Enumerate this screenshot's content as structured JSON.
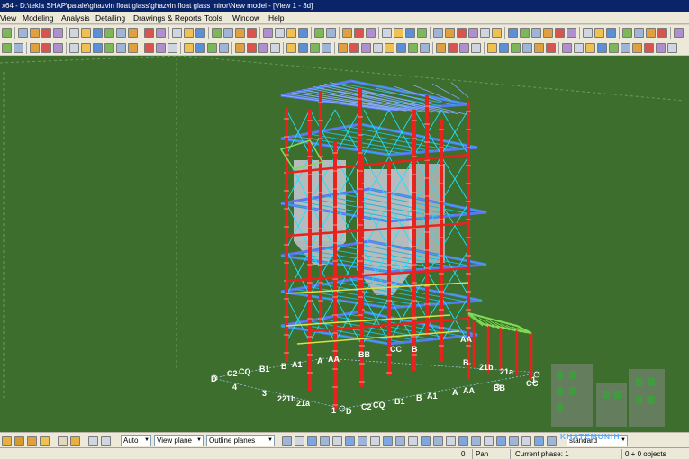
{
  "window": {
    "title": "x64 - D:\\tekla SHAP\\patale\\ghazvin float glass\\ghazvin float glass miror\\New model  - [View 1 - 3d]"
  },
  "menu": {
    "items": [
      "View",
      "Modeling",
      "Analysis",
      "Detailing",
      "Drawings & Reports",
      "Tools",
      "Window",
      "Help"
    ]
  },
  "bottom_toolbar": {
    "select_mode": "Auto",
    "work_plane": "View plane",
    "plane_type": "Outline planes"
  },
  "status": {
    "settings": "standard",
    "x": "0",
    "mode": "Pan",
    "phase": "Current phase: 1",
    "selection": "0 + 0 objects"
  },
  "axis_labels": {
    "front_row": [
      "4",
      "3",
      "2",
      "21b",
      "21a",
      "1"
    ],
    "front_grid": [
      "C2",
      "CQ",
      "B1",
      "B",
      "A1",
      "A",
      "AA"
    ],
    "bottom_grid": [
      "D",
      "C2",
      "CQ",
      "B1",
      "B",
      "A1",
      "A",
      "AA"
    ],
    "left_marks": [
      "D",
      "4"
    ],
    "right_row": [
      "BB",
      "21b",
      "21a",
      "1",
      "C",
      "C"
    ],
    "right_grid": [
      "BB",
      "B"
    ],
    "mid_marks": [
      "CC",
      "B"
    ],
    "wall_marks": [
      "AA"
    ]
  },
  "watermark": {
    "text": "KHATEMUNIH"
  },
  "colors": {
    "viewport_bg": "#3d6e2d",
    "column": "#e8231e",
    "beam": "#2bb5d4",
    "brace": "#1fe0ff",
    "floor": "#5a78f2",
    "secondary": "#7fdd55",
    "vessel": "#c9cad8"
  }
}
